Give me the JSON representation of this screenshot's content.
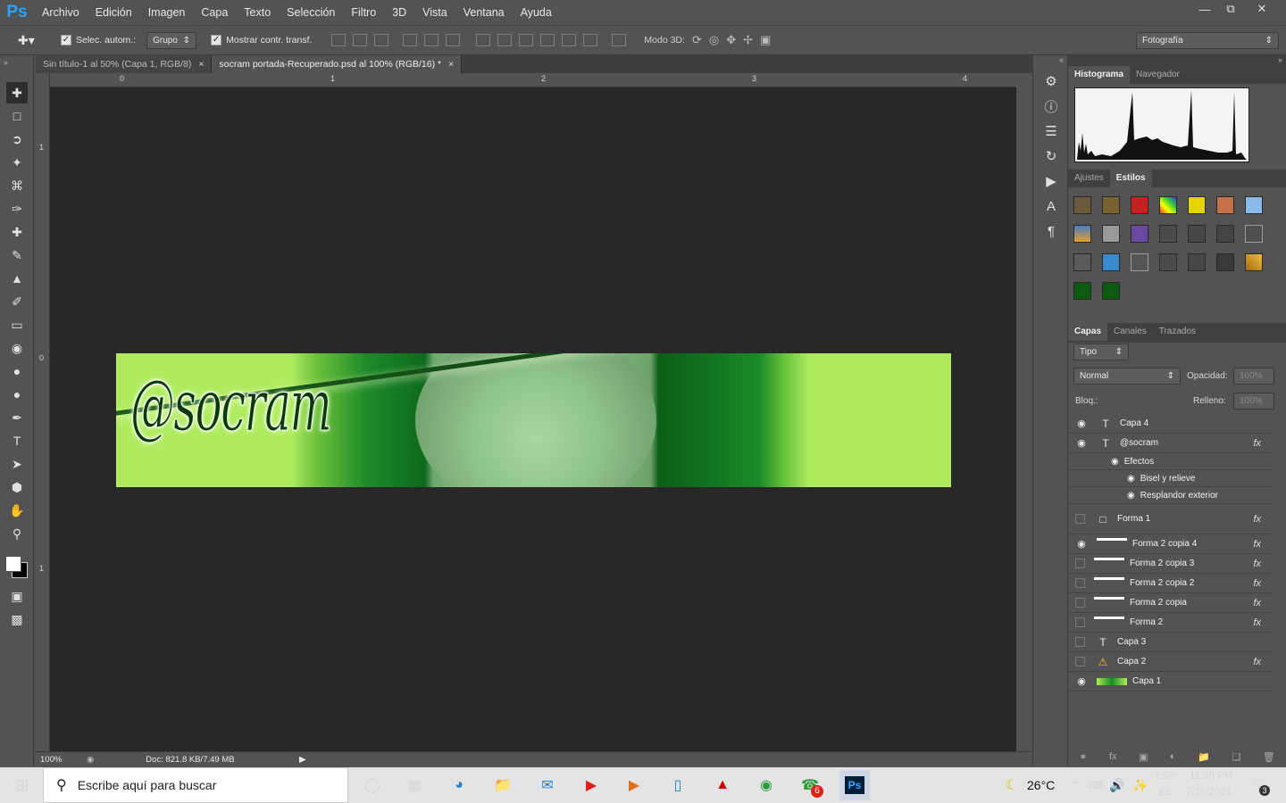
{
  "app": {
    "logo": "Ps"
  },
  "menu": [
    "Archivo",
    "Edición",
    "Imagen",
    "Capa",
    "Texto",
    "Selección",
    "Filtro",
    "3D",
    "Vista",
    "Ventana",
    "Ayuda"
  ],
  "options": {
    "auto_select_label": "Selec. autom.:",
    "auto_select_value": "Grupo",
    "show_transform_label": "Mostrar contr. transf.",
    "mode3d_label": "Modo 3D:",
    "workspace": "Fotografía"
  },
  "tabs": [
    {
      "label": "Sin título-1 al 50% (Capa 1, RGB/8)",
      "close": "×"
    },
    {
      "label": "socram portada-Recuperado.psd al 100% (RGB/16) *",
      "close": "×"
    }
  ],
  "ruler": {
    "top": [
      "0",
      "1",
      "2",
      "3",
      "4"
    ],
    "left": [
      "1",
      "0",
      "1"
    ]
  },
  "canvas": {
    "banner_text": "@socram"
  },
  "status": {
    "zoom": "100%",
    "doc": "Doc: 821.8 KB/7.49 MB"
  },
  "panels": {
    "top_tabs": [
      "Histograma",
      "Navegador"
    ],
    "mid_tabs": [
      "Ajustes",
      "Estilos"
    ],
    "layer_tabs": [
      "Capas",
      "Canales",
      "Trazados"
    ],
    "filter_kind": "Tipo",
    "blend_mode": "Normal",
    "opacity_label": "Opacidad:",
    "opacity_value": "100%",
    "lock_label": "Bloq.:",
    "fill_label": "Relleno:",
    "fill_value": "100%"
  },
  "layers": [
    {
      "name": "Capa 4",
      "visible": true,
      "type": "text",
      "fx": false
    },
    {
      "name": "@socram",
      "visible": true,
      "type": "text",
      "fx": true
    },
    {
      "name": "Efectos",
      "visible": true,
      "type": "effects",
      "fx": false
    },
    {
      "name": "Bisel y relieve",
      "visible": true,
      "type": "effect",
      "fx": false
    },
    {
      "name": "Resplandor exterior",
      "visible": true,
      "type": "effect",
      "fx": false
    },
    {
      "name": "Forma 1",
      "visible": false,
      "type": "shape",
      "fx": true
    },
    {
      "name": "Forma 2 copia 4",
      "visible": true,
      "type": "strip",
      "fx": true
    },
    {
      "name": "Forma 2 copia 3",
      "visible": false,
      "type": "strip",
      "fx": true
    },
    {
      "name": "Forma 2 copia 2",
      "visible": false,
      "type": "strip",
      "fx": true
    },
    {
      "name": "Forma 2 copia",
      "visible": false,
      "type": "strip",
      "fx": true
    },
    {
      "name": "Forma 2",
      "visible": false,
      "type": "strip",
      "fx": true
    },
    {
      "name": "Capa 3",
      "visible": false,
      "type": "text",
      "fx": false
    },
    {
      "name": "Capa 2",
      "visible": false,
      "type": "warning",
      "fx": true
    },
    {
      "name": "Capa 1",
      "visible": true,
      "type": "image",
      "fx": false
    }
  ],
  "taskbar": {
    "search_placeholder": "Escribe aquí para buscar",
    "weather": "26°C",
    "lang1": "ESP",
    "lang2": "ES",
    "time": "11:36 PM",
    "date": "7/16/2021",
    "notif": "3",
    "badge": "6"
  }
}
